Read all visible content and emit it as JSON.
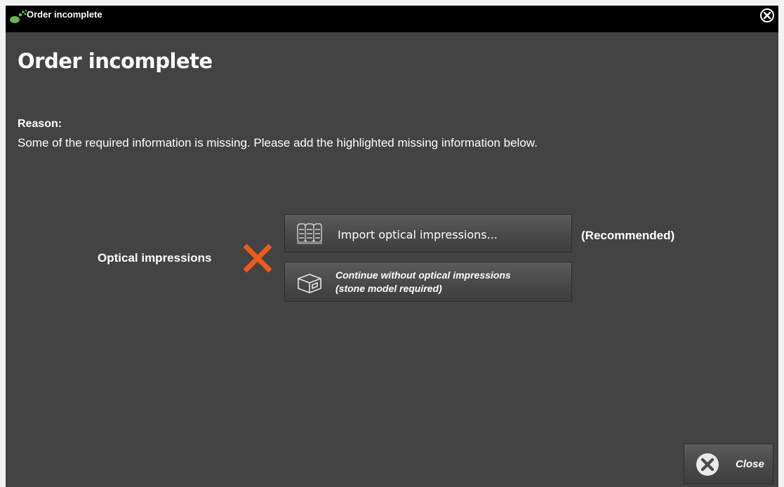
{
  "window": {
    "title": "Order incomplete",
    "icons": {
      "app": "app-logo-icon",
      "close": "close-circle-icon"
    }
  },
  "main": {
    "heading": "Order incomplete",
    "reason_label": "Reason:",
    "reason_text": "Some of the required information is missing. Please add the highlighted missing information below."
  },
  "optical": {
    "label": "Optical impressions",
    "status_icon": "missing-x-icon",
    "status_color": "#f05a1a",
    "import_button": {
      "label": "Import optical impressions...",
      "icon": "optical-impressions-icon"
    },
    "recommended": "(Recommended)",
    "continue_button": {
      "line1": "Continue without optical impressions",
      "line2": "(stone model required)",
      "icon": "stone-model-box-icon"
    }
  },
  "footer": {
    "close_label": "Close",
    "close_icon": "close-circle-icon"
  },
  "colors": {
    "background": "#434343",
    "titlebar": "#000000",
    "text": "#ffffff",
    "accent": "#f05a1a"
  }
}
